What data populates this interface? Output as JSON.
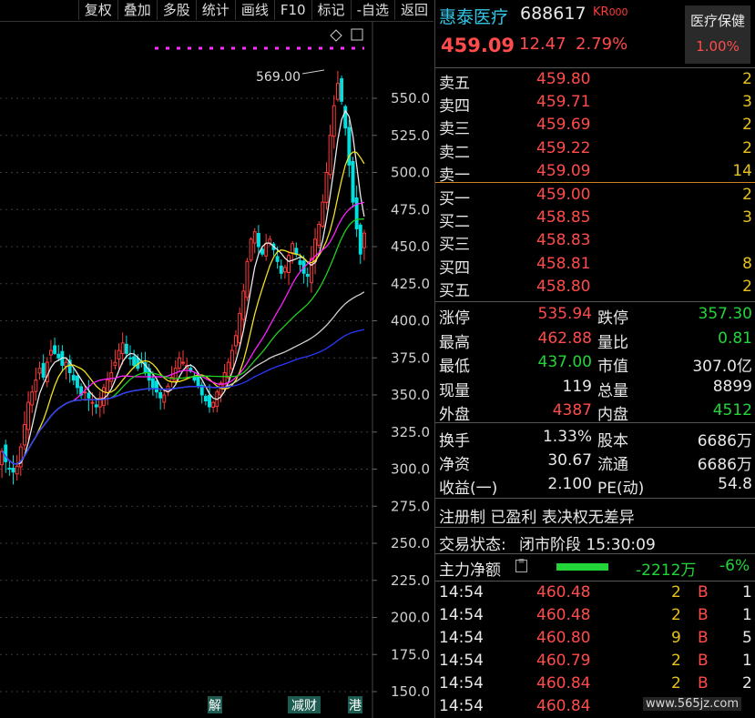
{
  "toolbar": [
    "复权",
    "叠加",
    "多股",
    "统计",
    "画线",
    "F10",
    "标记",
    "-自选",
    "返回"
  ],
  "chart": {
    "y_ticks": [
      "550.0",
      "525.0",
      "500.0",
      "475.0",
      "450.0",
      "425.0",
      "400.0",
      "375.0",
      "350.0",
      "325.0",
      "300.0",
      "275.0",
      "250.0",
      "225.0",
      "200.0",
      "175.0",
      "150.0"
    ],
    "high_label": "569.00",
    "badges": [
      "解",
      "减财",
      "港"
    ],
    "colors": {
      "up": "#ff3b3b",
      "down": "#00e0e0",
      "ma5": "#e8e8e8",
      "ma10": "#f0e020",
      "ma20": "#ff20ff",
      "ma30": "#20d020",
      "ma60": "#cfcfcf",
      "ma120": "#2838ff"
    }
  },
  "chart_data": {
    "type": "candlestick",
    "ylim": [
      140,
      575
    ],
    "y_ticks": [
      550,
      525,
      500,
      475,
      450,
      425,
      400,
      375,
      350,
      325,
      300,
      275,
      250,
      225,
      200,
      175,
      150
    ],
    "close": [
      312,
      305,
      300,
      298,
      302,
      315,
      330,
      345,
      352,
      360,
      368,
      362,
      372,
      380,
      378,
      375,
      370,
      372,
      365,
      360,
      355,
      350,
      352,
      348,
      345,
      342,
      348,
      355,
      360,
      365,
      372,
      380,
      385,
      378,
      375,
      370,
      368,
      372,
      365,
      360,
      355,
      352,
      348,
      350,
      356,
      362,
      368,
      375,
      372,
      370,
      366,
      360,
      356,
      350,
      346,
      342,
      345,
      352,
      358,
      365,
      372,
      380,
      390,
      405,
      420,
      440,
      455,
      460,
      450,
      445,
      452,
      455,
      448,
      440,
      432,
      436,
      444,
      452,
      445,
      438,
      432,
      430,
      442,
      455,
      465,
      480,
      500,
      525,
      545,
      560,
      548,
      530,
      505,
      480,
      462,
      445,
      459.09
    ]
  },
  "panel": {
    "name": "惠泰医疗",
    "code": "688617",
    "tag": "KR",
    "tag_sub": "000",
    "price": "459.09",
    "change": "12.47",
    "change_pct": "2.79%",
    "sector": "医疗保健",
    "sector_pct": "1.00%",
    "asks": [
      {
        "label": "卖五",
        "price": "459.80",
        "vol": "2"
      },
      {
        "label": "卖四",
        "price": "459.71",
        "vol": "3"
      },
      {
        "label": "卖三",
        "price": "459.69",
        "vol": "2"
      },
      {
        "label": "卖二",
        "price": "459.22",
        "vol": "2"
      },
      {
        "label": "卖一",
        "price": "459.09",
        "vol": "14"
      }
    ],
    "bids": [
      {
        "label": "买一",
        "price": "459.00",
        "vol": "2"
      },
      {
        "label": "买二",
        "price": "458.85",
        "vol": "3"
      },
      {
        "label": "买三",
        "price": "458.83",
        "vol": ""
      },
      {
        "label": "买四",
        "price": "458.81",
        "vol": "8"
      },
      {
        "label": "买五",
        "price": "458.80",
        "vol": "2"
      }
    ],
    "stats1": [
      {
        "l1": "涨停",
        "v1": "535.94",
        "c1": "red",
        "l2": "跌停",
        "v2": "357.30",
        "c2": "green"
      },
      {
        "l1": "最高",
        "v1": "462.88",
        "c1": "red",
        "l2": "量比",
        "v2": "0.81",
        "c2": "green"
      },
      {
        "l1": "最低",
        "v1": "437.00",
        "c1": "green",
        "l2": "市值",
        "v2": "307.0亿",
        "c2": "white"
      },
      {
        "l1": "现量",
        "v1": "119",
        "c1": "white",
        "l2": "总量",
        "v2": "8899",
        "c2": "white"
      },
      {
        "l1": "外盘",
        "v1": "4387",
        "c1": "red",
        "l2": "内盘",
        "v2": "4512",
        "c2": "green"
      }
    ],
    "stats2": [
      {
        "l1": "换手",
        "v1": "1.33%",
        "l2": "股本",
        "v2": "6686万"
      },
      {
        "l1": "净资",
        "v1": "30.67",
        "l2": "流通",
        "v2": "6686万"
      },
      {
        "l1": "收益(一)",
        "v1": "2.100",
        "l2": "PE(动)",
        "v2": "54.8"
      }
    ],
    "tags_line": "注册制 已盈利 表决权无差异",
    "status_label": "交易状态:",
    "status_value": "闭市阶段 15:30:09",
    "flow_label": "主力净额",
    "flow_value": "-2212万",
    "flow_pct": "-6%",
    "ticks": [
      {
        "time": "14:54",
        "price": "460.48",
        "vol": "2",
        "bs": "B",
        "n": "1"
      },
      {
        "time": "14:54",
        "price": "460.48",
        "vol": "2",
        "bs": "B",
        "n": "1"
      },
      {
        "time": "14:54",
        "price": "460.80",
        "vol": "9",
        "bs": "B",
        "n": "5"
      },
      {
        "time": "14:54",
        "price": "460.79",
        "vol": "2",
        "bs": "B",
        "n": "1"
      },
      {
        "time": "14:54",
        "price": "460.84",
        "vol": "2",
        "bs": "B",
        "n": "2"
      },
      {
        "time": "14:54",
        "price": "460.84",
        "vol": "",
        "bs": "",
        "n": ""
      }
    ],
    "watermark": "www.565jz.com"
  }
}
